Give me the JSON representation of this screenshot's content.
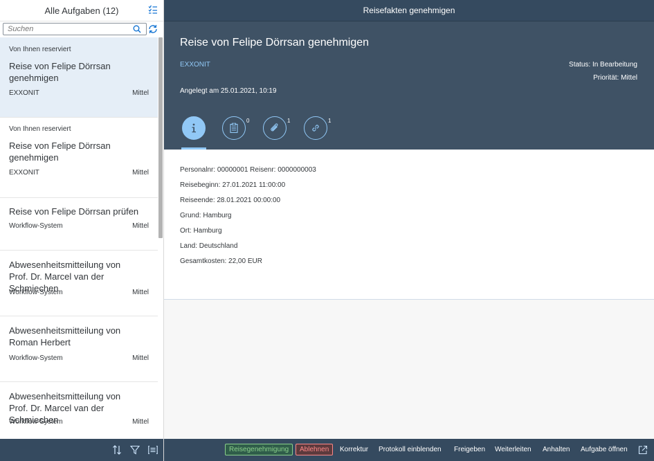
{
  "master": {
    "title": "Alle Aufgaben (12)",
    "search_placeholder": "Suchen",
    "items": [
      {
        "reserved": "Von Ihnen reserviert",
        "title": "Reise von Felipe Dörrsan genehmigen",
        "subtitle": "EXXONIT",
        "priority": "Mittel",
        "selected": true
      },
      {
        "reserved": "Von Ihnen reserviert",
        "title": "Reise von Felipe Dörrsan genehmigen",
        "subtitle": "EXXONIT",
        "priority": "Mittel",
        "selected": false
      },
      {
        "reserved": "",
        "title": "Reise von Felipe Dörrsan prüfen",
        "subtitle": "Workflow-System",
        "priority": "Mittel",
        "selected": false
      },
      {
        "reserved": "",
        "title": "Abwesenheitsmitteilung von Prof. Dr. Marcel van der Schmiechen",
        "subtitle": "Workflow-System",
        "priority": "Mittel",
        "selected": false
      },
      {
        "reserved": "",
        "title": "Abwesenheitsmitteilung von Roman Herbert",
        "subtitle": "Workflow-System",
        "priority": "Mittel",
        "selected": false
      },
      {
        "reserved": "",
        "title": "Abwesenheitsmitteilung von Prof. Dr. Marcel van der Schmiechen",
        "subtitle": "Workflow-System",
        "priority": "Mittel",
        "selected": false
      }
    ],
    "footer_icons": [
      "sort-icon",
      "filter-icon",
      "group-icon"
    ]
  },
  "detail": {
    "bar_title": "Reisefakten genehmigen",
    "header": {
      "title": "Reise von Felipe Dörrsan genehmigen",
      "subtitle": "EXXONIT",
      "status": "Status: In Bearbeitung",
      "priority": "Priorität: Mittel",
      "created": "Angelegt am 25.01.2021, 10:19"
    },
    "tabs": [
      {
        "icon": "info-icon",
        "count": "",
        "active": true
      },
      {
        "icon": "notes-icon",
        "count": "0",
        "active": false
      },
      {
        "icon": "attachment-icon",
        "count": "1",
        "active": false
      },
      {
        "icon": "link-icon",
        "count": "1",
        "active": false
      }
    ],
    "fields": [
      "Personalnr: 00000001 Reisenr: 0000000003",
      "Reisebeginn: 27.01.2021 11:00:00",
      "Reiseende: 28.01.2021 00:00:00",
      "Grund: Hamburg",
      "Ort: Hamburg",
      "Land: Deutschland",
      "Gesamtkosten: 22,00 EUR"
    ],
    "footer_buttons": {
      "approve": "Reisegenehmigung",
      "reject": "Ablehnen",
      "correction": "Korrektur",
      "show_log": "Protokoll einblenden",
      "release": "Freigeben",
      "forward": "Weiterleiten",
      "suspend": "Anhalten",
      "open_task": "Aufgabe öffnen"
    }
  },
  "colors": {
    "shell": "#354a5f",
    "header": "#3f5265",
    "accent": "#91c8f6",
    "selected_item": "#e5eef7",
    "accept": "#8bd08b",
    "reject": "#ff8888"
  }
}
